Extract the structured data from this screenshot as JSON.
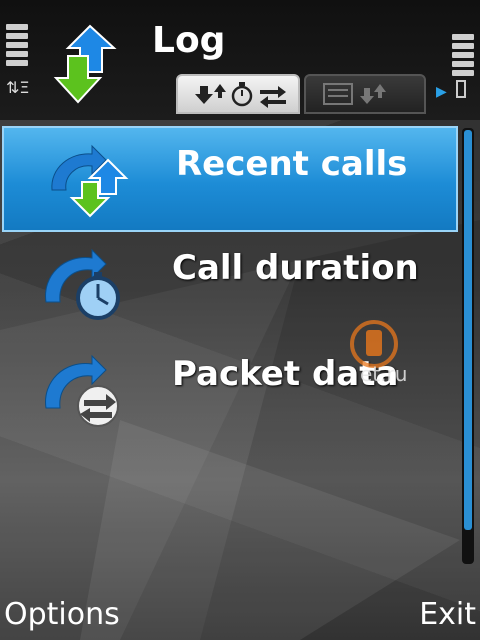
{
  "header": {
    "title": "Log",
    "tabs": [
      {
        "icons": [
          "download-arrow",
          "upload-arrow",
          "stopwatch",
          "transfer-arrows"
        ],
        "active": true
      },
      {
        "icons": [
          "message-list",
          "download-arrow",
          "upload-arrow"
        ],
        "active": false
      }
    ]
  },
  "menu": {
    "items": [
      {
        "label": "Recent calls",
        "icon": "recent-calls-icon",
        "selected": true
      },
      {
        "label": "Call duration",
        "icon": "call-duration-icon",
        "selected": false
      },
      {
        "label": "Packet data",
        "icon": "packet-data-icon",
        "selected": false
      }
    ]
  },
  "watermark": {
    "text": "et.ru"
  },
  "softkeys": {
    "left": "Options",
    "right": "Exit"
  },
  "colors": {
    "accent": "#1d8cd6",
    "highlight_border": "#9ad4f7",
    "download_green": "#5cc21e",
    "upload_blue": "#1e88e5"
  }
}
